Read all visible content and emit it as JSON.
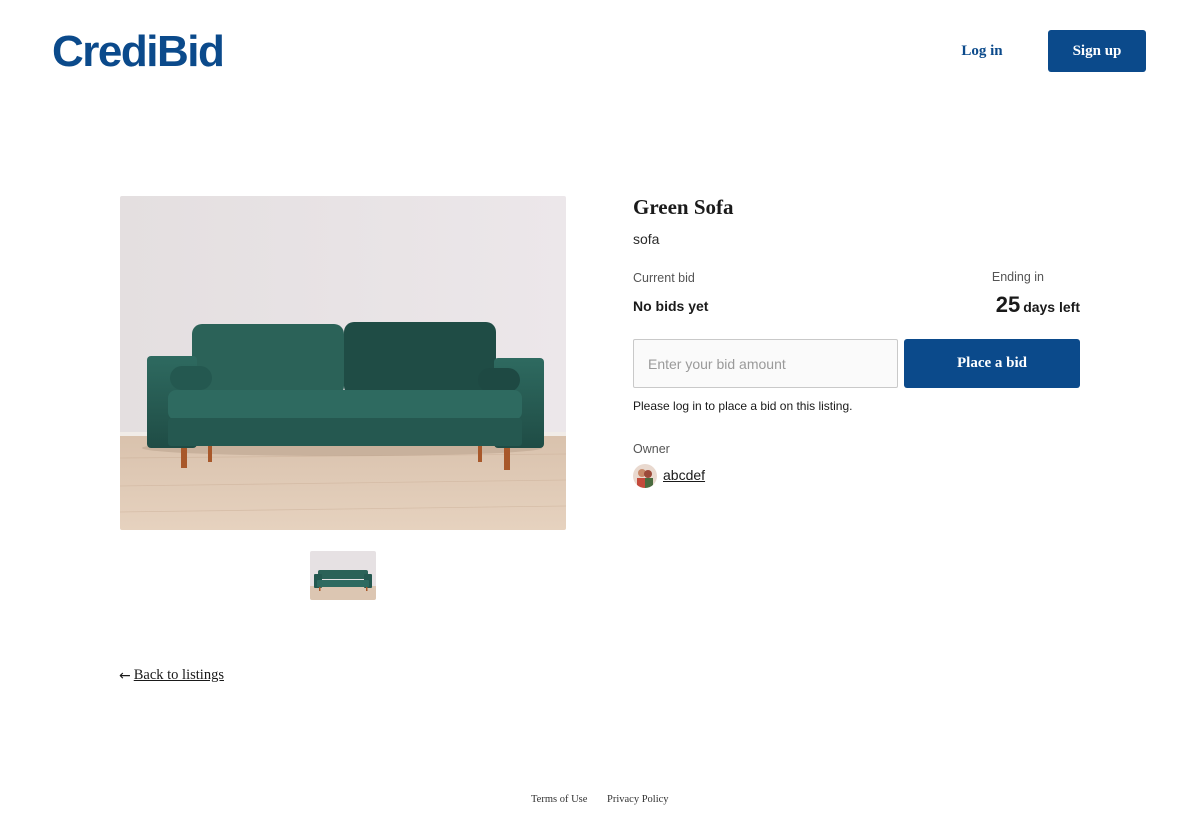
{
  "header": {
    "logo_text": "CrediBid",
    "login_label": "Log in",
    "signup_label": "Sign up",
    "brand_color": "#0b4a8b"
  },
  "listing": {
    "title": "Green Sofa",
    "category": "sofa",
    "current_bid_label": "Current bid",
    "current_bid_value": "No bids yet",
    "ending_label": "Ending in",
    "days_left_number": "25",
    "days_left_unit": "days left",
    "bid_input_placeholder": "Enter your bid amount",
    "bid_input_value": "",
    "place_bid_label": "Place a bid",
    "login_note": "Please log in to place a bid on this listing.",
    "owner_label": "Owner",
    "owner_name": "abcdef",
    "images": {
      "main": "green-sofa-photo",
      "thumbnails": [
        "green-sofa-photo"
      ]
    }
  },
  "navigation": {
    "back_arrow_icon": "arrow-left-icon",
    "back_label": "Back to listings"
  },
  "footer": {
    "terms_label": "Terms of Use",
    "privacy_label": "Privacy Policy"
  }
}
